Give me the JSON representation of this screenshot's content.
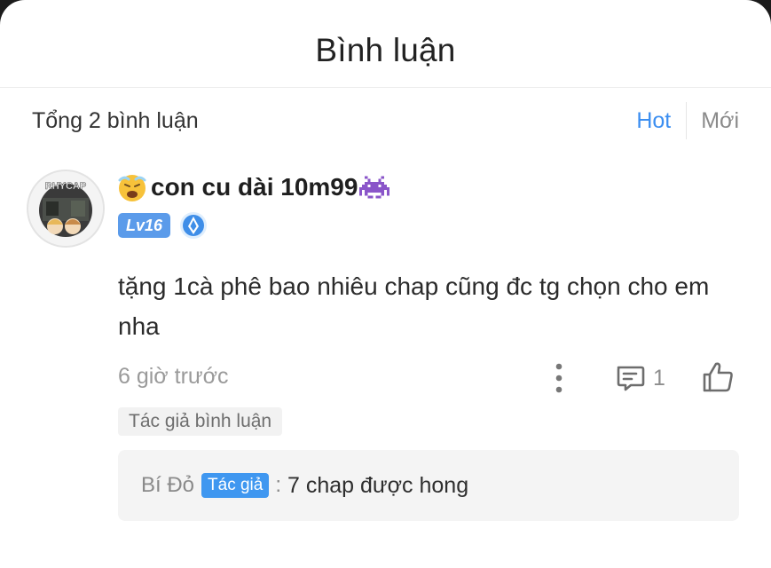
{
  "header": {
    "title": "Bình luận"
  },
  "summary": {
    "total_text": "Tổng 2 bình luận"
  },
  "sort_tabs": [
    {
      "label": "Hot",
      "active": true
    },
    {
      "label": "Mới",
      "active": false
    }
  ],
  "comment": {
    "username": "con cu dài 10m99",
    "leading_emoji": "tired-face-emoji",
    "trailing_emoji": "space-invader-emoji",
    "avatar_caption": "RHYCAP",
    "level_badge": "Lv16",
    "badge_icon": "blue-medal-icon",
    "text": "tặng 1cà phê bao nhiêu chap cũng đc tg chọn cho em nha",
    "timestamp": "6 giờ trước",
    "reply_count": "1",
    "author_tag": "Tác giả bình luận",
    "reply": {
      "author": "Bí Đỏ",
      "author_badge": "Tác giả",
      "separator": ":",
      "text": "7 chap được hong"
    }
  },
  "colors": {
    "accent": "#3b8ef1",
    "level_badge": "#5b9bea",
    "author_chip": "#3f97f0"
  }
}
